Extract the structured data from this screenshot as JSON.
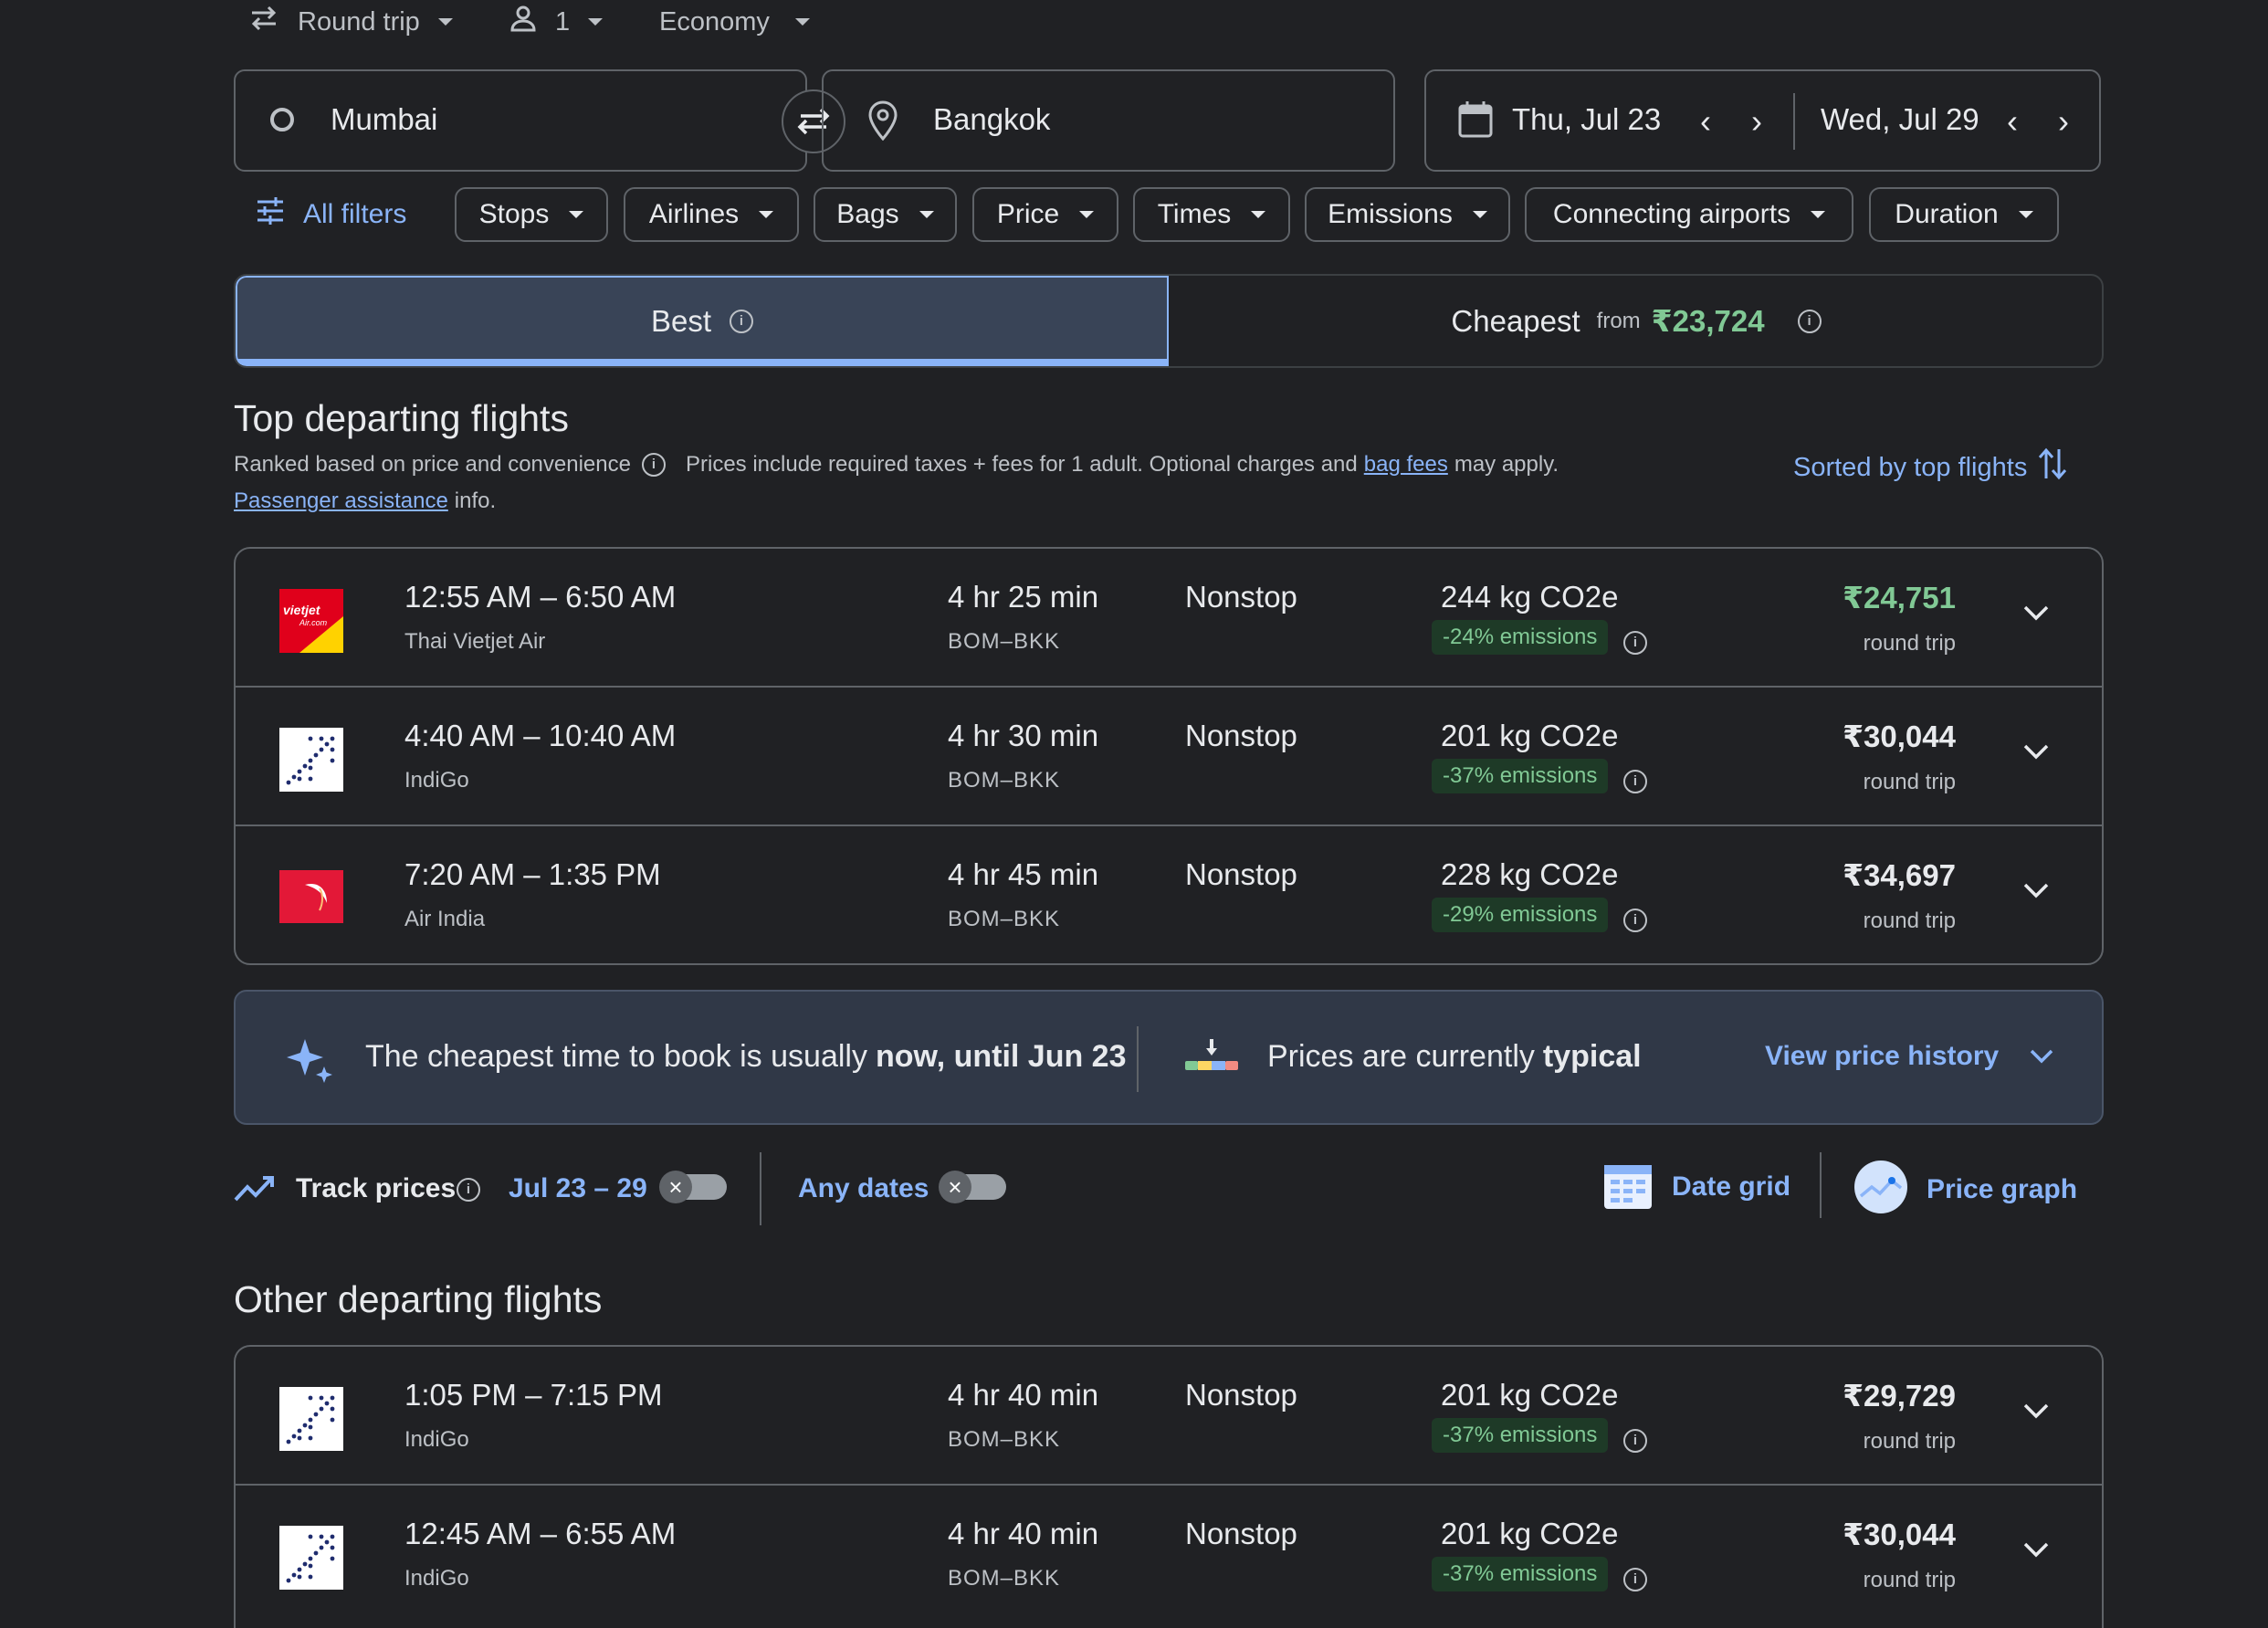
{
  "trip": {
    "type": "Round trip",
    "passengers": "1",
    "cabin": "Economy"
  },
  "search": {
    "origin": "Mumbai",
    "destination": "Bangkok",
    "depart_date": "Thu, Jul 23",
    "return_date": "Wed, Jul 29"
  },
  "filters": {
    "all": "All filters",
    "chips": [
      "Stops",
      "Airlines",
      "Bags",
      "Price",
      "Times",
      "Emissions",
      "Connecting airports",
      "Duration"
    ]
  },
  "sort_tabs": {
    "best": "Best",
    "cheapest": "Cheapest",
    "cheapest_from": "from",
    "cheapest_price": "₹23,724"
  },
  "top": {
    "heading": "Top departing flights",
    "ranked_text": "Ranked based on price and convenience",
    "prices_text_1": "Prices include required taxes + fees for 1 adult. Optional charges and",
    "bag_fees_link": "bag fees",
    "prices_text_2": "may apply.",
    "passenger_link": "Passenger assistance",
    "info_text": "info.",
    "sorted_label": "Sorted by top flights"
  },
  "top_flights": [
    {
      "times": "12:55 AM – 6:50 AM",
      "airline": "Thai Vietjet Air",
      "duration": "4 hr 25 min",
      "route": "BOM–BKK",
      "stops": "Nonstop",
      "co2": "244 kg CO2e",
      "emissions": "-24% emissions",
      "price": "₹24,751",
      "price_type": "round trip",
      "logo": "vietjet",
      "price_color": "#81c995"
    },
    {
      "times": "4:40 AM – 10:40 AM",
      "airline": "IndiGo",
      "duration": "4 hr 30 min",
      "route": "BOM–BKK",
      "stops": "Nonstop",
      "co2": "201 kg CO2e",
      "emissions": "-37% emissions",
      "price": "₹30,044",
      "price_type": "round trip",
      "logo": "indigo",
      "price_color": "#e8eaed"
    },
    {
      "times": "7:20 AM – 1:35 PM",
      "airline": "Air India",
      "duration": "4 hr 45 min",
      "route": "BOM–BKK",
      "stops": "Nonstop",
      "co2": "228 kg CO2e",
      "emissions": "-29% emissions",
      "price": "₹34,697",
      "price_type": "round trip",
      "logo": "airindia",
      "price_color": "#e8eaed"
    }
  ],
  "insight": {
    "cheapest_text": "The cheapest time to book is usually",
    "cheapest_bold": "now, until Jun 23",
    "prices_text": "Prices are currently",
    "prices_bold": "typical",
    "view_history": "View price history"
  },
  "tracking": {
    "track_label": "Track prices",
    "date_range": "Jul 23 – 29",
    "any_dates": "Any dates",
    "date_grid": "Date grid",
    "price_graph": "Price graph"
  },
  "other": {
    "heading": "Other departing flights"
  },
  "other_flights": [
    {
      "times": "1:05 PM – 7:15 PM",
      "airline": "IndiGo",
      "duration": "4 hr 40 min",
      "route": "BOM–BKK",
      "stops": "Nonstop",
      "co2": "201 kg CO2e",
      "emissions": "-37% emissions",
      "price": "₹29,729",
      "price_type": "round trip",
      "logo": "indigo",
      "price_color": "#e8eaed"
    },
    {
      "times": "12:45 AM – 6:55 AM",
      "airline": "IndiGo",
      "duration": "4 hr 40 min",
      "route": "BOM–BKK",
      "stops": "Nonstop",
      "co2": "201 kg CO2e",
      "emissions": "-37% emissions",
      "price": "₹30,044",
      "price_type": "round trip",
      "logo": "indigo",
      "price_color": "#e8eaed"
    }
  ],
  "colors": {
    "background": "#202124",
    "accent": "#8ab4f8",
    "green": "#81c995",
    "border": "#5f6368"
  }
}
